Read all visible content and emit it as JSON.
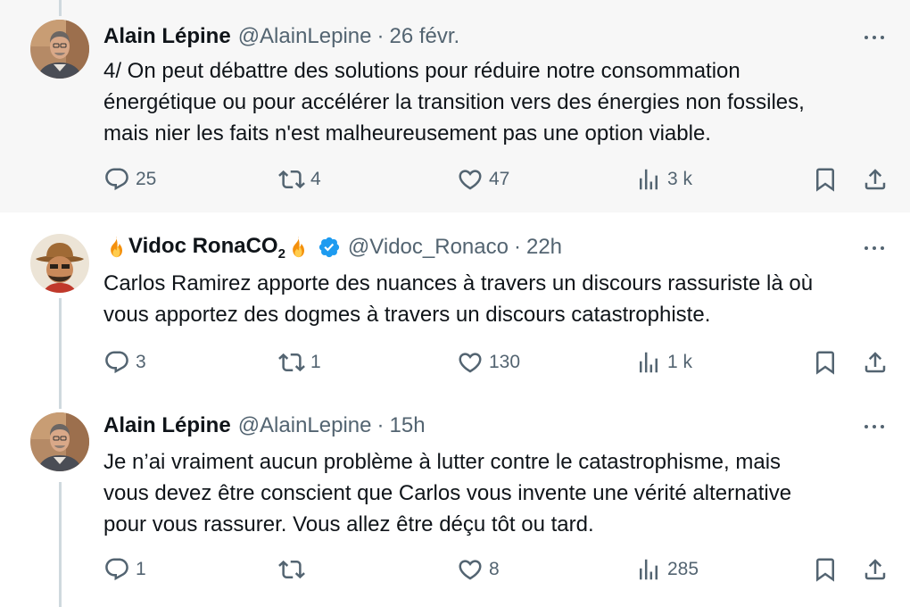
{
  "tweets": [
    {
      "author_name": "Alain Lépine",
      "handle": "@AlainLepine",
      "separator": "·",
      "time": "26 févr.",
      "text_lines": [
        "4/ On peut débattre des solutions pour réduire notre consommation",
        "énergétique ou pour accélérer la transition vers des énergies non fossiles,",
        "mais nier les faits n'est malheureusement pas une option viable."
      ],
      "replies": "25",
      "retweets": "4",
      "likes": "47",
      "views": "3 k"
    },
    {
      "author_name": "Vidoc RonaCO",
      "author_subscript": "2",
      "handle": "@Vidoc_Ronaco",
      "separator": "·",
      "time": "22h",
      "text_lines": [
        "Carlos Ramirez apporte des nuances à travers un discours rassuriste là où",
        "vous apportez des dogmes à travers un discours catastrophiste."
      ],
      "replies": "3",
      "retweets": "1",
      "likes": "130",
      "views": "1 k"
    },
    {
      "author_name": "Alain Lépine",
      "handle": "@AlainLepine",
      "separator": "·",
      "time": "15h",
      "text_lines": [
        "Je n’ai vraiment aucun problème à lutter contre le catastrophisme, mais",
        "vous devez être conscient que Carlos vous invente une vérité alternative",
        "pour vous rassurer. Vous allez être déçu tôt ou tard."
      ],
      "replies": "1",
      "retweets": "",
      "likes": "8",
      "views": "285"
    }
  ],
  "icons": {
    "reply": "reply-icon",
    "retweet": "retweet-icon",
    "like": "heart-icon",
    "views": "views-icon",
    "bookmark": "bookmark-icon",
    "share": "share-icon",
    "more": "more-icon",
    "fire": "fire-icon",
    "verified": "verified-badge-icon"
  },
  "colors": {
    "text": "#0f1419",
    "secondary": "#536471",
    "verified": "#1d9bf0",
    "highlight_bg": "#f7f7f7",
    "thread_line": "#cfd9de"
  }
}
